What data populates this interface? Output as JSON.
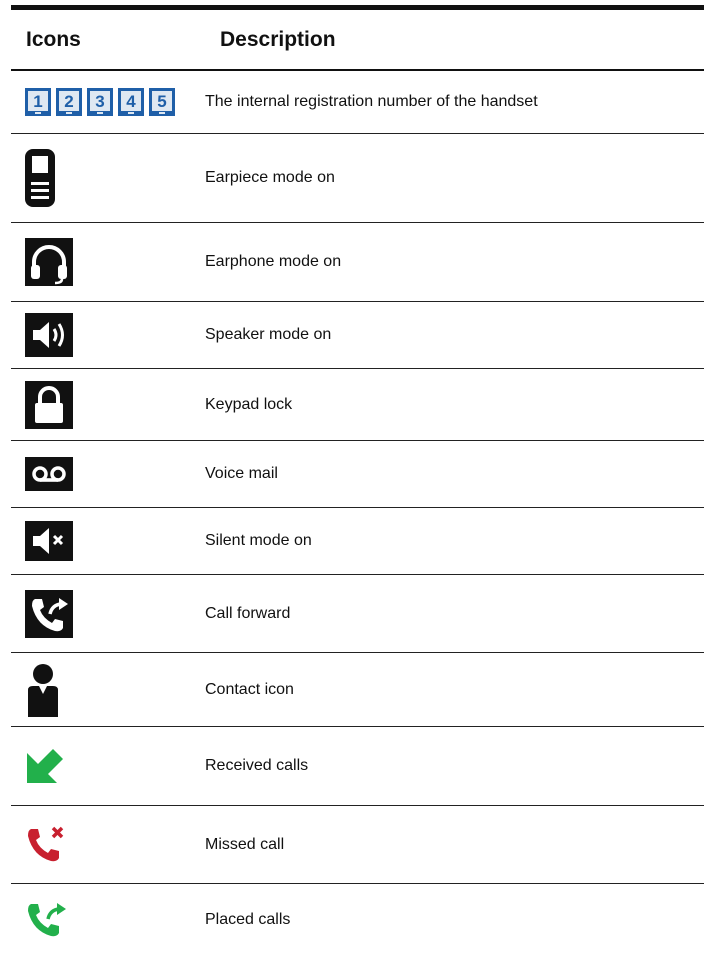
{
  "table": {
    "header": {
      "icons": "Icons",
      "description": "Description"
    },
    "rows": [
      {
        "icon": "registration-number-icons",
        "digits": [
          "1",
          "2",
          "3",
          "4",
          "5"
        ],
        "description": "The internal registration number of the handset"
      },
      {
        "icon": "earpiece-icon",
        "description": "Earpiece mode on"
      },
      {
        "icon": "headset-icon",
        "description": "Earphone mode on"
      },
      {
        "icon": "speaker-icon",
        "description": "Speaker mode on"
      },
      {
        "icon": "lock-icon",
        "description": "Keypad lock"
      },
      {
        "icon": "voicemail-icon",
        "description": "Voice mail"
      },
      {
        "icon": "speaker-muted-icon",
        "description": "Silent mode on"
      },
      {
        "icon": "call-forward-icon",
        "description": "Call forward"
      },
      {
        "icon": "contact-person-icon",
        "description": "Contact icon"
      },
      {
        "icon": "received-call-arrow-icon",
        "description": "Received calls"
      },
      {
        "icon": "missed-call-icon",
        "description": "Missed call"
      },
      {
        "icon": "placed-call-icon",
        "description": "Placed calls"
      }
    ]
  },
  "colors": {
    "rule": "#111111",
    "icon_dark": "#111111",
    "registration_blue": "#1f5fa8",
    "received_green": "#22b04b",
    "missed_red": "#c8202f",
    "placed_green": "#22b04b"
  }
}
